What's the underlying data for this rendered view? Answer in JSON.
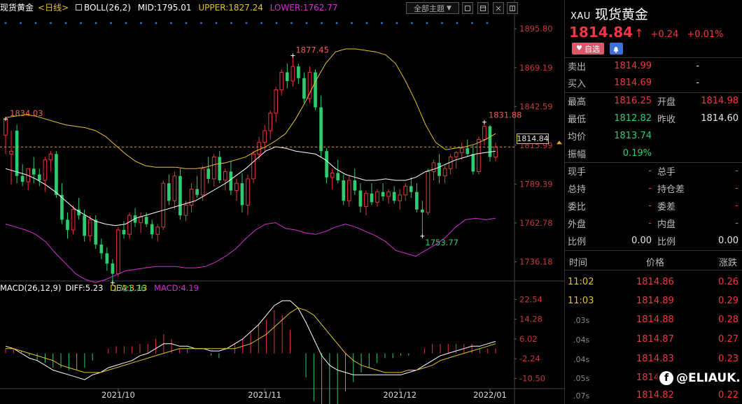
{
  "header": {
    "title": "现货黄金",
    "period": "<日线>",
    "boll": "BOLL(26,2)",
    "mid": "MID:1795.01",
    "upper": "UPPER:1827.24",
    "lower": "LOWER:1762.77",
    "theme_select": "全部主题",
    "theme_arrow": "▼"
  },
  "macd_header": {
    "label": "MACD(26,12,9)",
    "diff": "DIFF:5.23",
    "dea": "DEA:3.13",
    "macd": "MACD:4.19"
  },
  "current_price_tag": "1814.84",
  "chart_data": [
    {
      "type": "candlestick",
      "x_labels": [
        "2021/10",
        "2021/11",
        "2021/12",
        "2022/01"
      ],
      "price_axis_ticks": [
        "1895.80",
        "1869.19",
        "1842.59",
        "1815.99",
        "1789.39",
        "1762.78",
        "1736.18"
      ],
      "ylim": [
        1724,
        1905
      ],
      "annotations": [
        {
          "label": "1834.03",
          "value": 1834.03
        },
        {
          "label": "1721.76",
          "value": 1721.76
        },
        {
          "label": "1877.45",
          "value": 1877.45
        },
        {
          "label": "1753.77",
          "value": 1753.77
        },
        {
          "label": "1831.88",
          "value": 1831.88
        }
      ],
      "current_price_line": 1814.84,
      "candles": [
        [
          1823,
          1828,
          1810,
          1834.03
        ],
        [
          1810,
          1826,
          1789,
          1812
        ],
        [
          1826,
          1830,
          1790,
          1795
        ],
        [
          1795,
          1803,
          1788,
          1791
        ],
        [
          1791,
          1798,
          1785,
          1800
        ],
        [
          1800,
          1808,
          1790,
          1796
        ],
        [
          1796,
          1800,
          1788,
          1792
        ],
        [
          1792,
          1808,
          1784,
          1806
        ],
        [
          1806,
          1812,
          1798,
          1810
        ],
        [
          1810,
          1812,
          1780,
          1782
        ],
        [
          1782,
          1790,
          1762,
          1765
        ],
        [
          1765,
          1770,
          1752,
          1758
        ],
        [
          1758,
          1775,
          1755,
          1772
        ],
        [
          1772,
          1780,
          1765,
          1768
        ],
        [
          1768,
          1772,
          1750,
          1754
        ],
        [
          1754,
          1768,
          1750,
          1765
        ],
        [
          1765,
          1768,
          1745,
          1748
        ],
        [
          1748,
          1752,
          1738,
          1742
        ],
        [
          1742,
          1746,
          1730,
          1735
        ],
        [
          1735,
          1738,
          1721.76,
          1728
        ],
        [
          1728,
          1760,
          1726,
          1758
        ],
        [
          1758,
          1764,
          1752,
          1755
        ],
        [
          1755,
          1770,
          1752,
          1768
        ],
        [
          1768,
          1773,
          1760,
          1763
        ],
        [
          1763,
          1770,
          1756,
          1767
        ],
        [
          1767,
          1770,
          1760,
          1762
        ],
        [
          1762,
          1765,
          1752,
          1755
        ],
        [
          1755,
          1762,
          1750,
          1760
        ],
        [
          1760,
          1792,
          1758,
          1790
        ],
        [
          1790,
          1796,
          1775,
          1778
        ],
        [
          1778,
          1798,
          1772,
          1795
        ],
        [
          1795,
          1800,
          1765,
          1768
        ],
        [
          1768,
          1778,
          1764,
          1775
        ],
        [
          1775,
          1790,
          1770,
          1786
        ],
        [
          1786,
          1795,
          1780,
          1782
        ],
        [
          1782,
          1802,
          1778,
          1800
        ],
        [
          1800,
          1808,
          1790,
          1793
        ],
        [
          1793,
          1810,
          1788,
          1808
        ],
        [
          1808,
          1812,
          1790,
          1792
        ],
        [
          1792,
          1800,
          1785,
          1798
        ],
        [
          1798,
          1805,
          1782,
          1785
        ],
        [
          1785,
          1793,
          1778,
          1790
        ],
        [
          1790,
          1797,
          1770,
          1775
        ],
        [
          1775,
          1796,
          1768,
          1793
        ],
        [
          1793,
          1812,
          1790,
          1810
        ],
        [
          1810,
          1822,
          1806,
          1818
        ],
        [
          1818,
          1830,
          1812,
          1826
        ],
        [
          1826,
          1840,
          1820,
          1838
        ],
        [
          1838,
          1856,
          1832,
          1854
        ],
        [
          1854,
          1868,
          1850,
          1866
        ],
        [
          1866,
          1872,
          1855,
          1860
        ],
        [
          1860,
          1877.45,
          1856,
          1870
        ],
        [
          1870,
          1872,
          1858,
          1862
        ],
        [
          1862,
          1866,
          1845,
          1848
        ],
        [
          1848,
          1870,
          1845,
          1866
        ],
        [
          1866,
          1868,
          1840,
          1842
        ],
        [
          1842,
          1850,
          1808,
          1812
        ],
        [
          1812,
          1814,
          1790,
          1794
        ],
        [
          1794,
          1800,
          1786,
          1797
        ],
        [
          1797,
          1806,
          1790,
          1792
        ],
        [
          1792,
          1796,
          1775,
          1778
        ],
        [
          1778,
          1795,
          1774,
          1792
        ],
        [
          1792,
          1800,
          1782,
          1785
        ],
        [
          1785,
          1790,
          1770,
          1774
        ],
        [
          1774,
          1785,
          1768,
          1783
        ],
        [
          1783,
          1790,
          1775,
          1777
        ],
        [
          1777,
          1786,
          1774,
          1784
        ],
        [
          1784,
          1790,
          1778,
          1781
        ],
        [
          1781,
          1786,
          1776,
          1784
        ],
        [
          1784,
          1788,
          1776,
          1778
        ],
        [
          1778,
          1786,
          1772,
          1782
        ],
        [
          1782,
          1790,
          1778,
          1788
        ],
        [
          1788,
          1794,
          1780,
          1784
        ],
        [
          1784,
          1790,
          1770,
          1772
        ],
        [
          1772,
          1778,
          1753.77,
          1770
        ],
        [
          1770,
          1800,
          1768,
          1798
        ],
        [
          1798,
          1806,
          1792,
          1804
        ],
        [
          1804,
          1810,
          1790,
          1795
        ],
        [
          1795,
          1802,
          1790,
          1800
        ],
        [
          1800,
          1810,
          1796,
          1808
        ],
        [
          1808,
          1812,
          1800,
          1811
        ],
        [
          1811,
          1818,
          1806,
          1814
        ],
        [
          1814,
          1820,
          1808,
          1810
        ],
        [
          1810,
          1816,
          1796,
          1798
        ],
        [
          1798,
          1822,
          1796,
          1820
        ],
        [
          1820,
          1831.88,
          1816,
          1829
        ],
        [
          1829,
          1830,
          1805,
          1808
        ],
        [
          1808,
          1818,
          1805,
          1814.84
        ]
      ],
      "boll_upper": [
        1835,
        1836,
        1837,
        1836,
        1834,
        1832,
        1830,
        1829,
        1828,
        1826,
        1822,
        1816,
        1810,
        1805,
        1802,
        1801,
        1801,
        1801,
        1800,
        1800,
        1801,
        1803,
        1804,
        1806,
        1808,
        1812,
        1815,
        1819,
        1824,
        1834,
        1846,
        1860,
        1872,
        1880,
        1882,
        1882,
        1881,
        1880,
        1878,
        1872,
        1860,
        1846,
        1830,
        1818,
        1813,
        1814,
        1815,
        1817,
        1820,
        1824
      ],
      "boll_mid": [
        1800,
        1798,
        1796,
        1793,
        1789,
        1784,
        1778,
        1772,
        1768,
        1764,
        1762,
        1761,
        1762,
        1766,
        1768,
        1770,
        1772,
        1774,
        1776,
        1778,
        1782,
        1786,
        1790,
        1795,
        1800,
        1806,
        1812,
        1815,
        1814,
        1812,
        1811,
        1810,
        1806,
        1800,
        1796,
        1794,
        1792,
        1792,
        1793,
        1792,
        1792,
        1794,
        1798,
        1800,
        1803,
        1806,
        1808,
        1810,
        1811,
        1812
      ],
      "boll_lower": [
        1762,
        1760,
        1758,
        1755,
        1750,
        1742,
        1735,
        1728,
        1724,
        1722,
        1724,
        1727,
        1730,
        1731,
        1732,
        1733,
        1733,
        1733,
        1732,
        1732,
        1733,
        1736,
        1740,
        1745,
        1752,
        1758,
        1762,
        1763,
        1759,
        1758,
        1756,
        1755,
        1757,
        1760,
        1762,
        1760,
        1757,
        1754,
        1750,
        1744,
        1742,
        1740,
        1744,
        1748,
        1753,
        1760,
        1765,
        1766,
        1765,
        1766
      ]
    },
    {
      "type": "macd",
      "axis_ticks": [
        "22.54",
        "14.28",
        "6.02",
        "-2.24",
        "-10.50"
      ],
      "ylim": [
        -13,
        25
      ],
      "diff": [
        3,
        2,
        0,
        -2,
        -3,
        -5,
        -7,
        -8,
        -9,
        -10,
        -11,
        -9,
        -8,
        -6,
        -5,
        -4,
        -3,
        -1,
        0,
        2,
        4,
        4,
        3,
        3,
        2,
        2,
        1,
        1,
        2,
        4,
        6,
        9,
        12,
        16,
        20,
        22,
        22,
        19,
        13,
        6,
        -1,
        -5,
        -7,
        -8,
        -9,
        -9,
        -9,
        -9,
        -9,
        -9,
        -9,
        -8,
        -7,
        -5,
        -3,
        -1,
        0,
        1,
        2,
        3,
        3,
        4,
        5
      ],
      "dea": [
        2,
        2,
        1,
        0,
        -1,
        -2,
        -3,
        -5,
        -6,
        -7,
        -8,
        -8,
        -8,
        -7,
        -6,
        -5,
        -4,
        -3,
        -2,
        -1,
        0,
        1,
        2,
        2,
        2,
        2,
        2,
        2,
        2,
        2,
        3,
        4,
        6,
        8,
        11,
        14,
        17,
        19,
        18,
        16,
        12,
        8,
        4,
        0,
        -3,
        -5,
        -6,
        -7,
        -8,
        -8,
        -8,
        -7,
        -7,
        -6,
        -5,
        -3,
        -2,
        -1,
        0,
        1,
        2,
        3,
        4
      ],
      "macd_hist": [
        2,
        2,
        1,
        -1,
        -3,
        -4,
        -6,
        -6,
        -7,
        -7,
        -6,
        -3,
        0,
        2,
        3,
        3,
        3,
        4,
        4,
        6,
        8,
        6,
        2,
        2,
        0,
        0,
        -1,
        -2,
        0,
        4,
        6,
        9,
        12,
        14,
        18,
        16,
        10,
        0,
        -10,
        -20,
        -26,
        -26,
        -22,
        -16,
        -12,
        -8,
        -6,
        -4,
        -2,
        -2,
        -1,
        -1,
        0,
        2,
        4,
        4,
        4,
        4,
        4,
        4,
        2,
        2,
        2
      ]
    }
  ],
  "quote": {
    "code": "XAU",
    "name": "现货黄金",
    "price": "1814.84",
    "arrow": "↑",
    "change": "+0.24",
    "change_pct": "+0.01%",
    "fav_label": "自选",
    "sell_label": "卖出",
    "sell": "1814.99",
    "sell_vol": "-",
    "buy_label": "买入",
    "buy": "1814.69",
    "buy_vol": "-",
    "high_label": "最高",
    "high": "1816.25",
    "open_label": "开盘",
    "open": "1814.98",
    "low_label": "最低",
    "low": "1812.82",
    "prev_label": "昨收",
    "prev": "1814.60",
    "avg_label": "均价",
    "avg": "1813.74",
    "amp_label": "振幅",
    "amp": "0.19%",
    "cur_hand_label": "现手",
    "cur_hand": "-",
    "total_hand_label": "总手",
    "total_hand": "-",
    "total_vol_label": "总持",
    "total_vol": "-",
    "pos_diff_label": "持仓差",
    "pos_diff": "-",
    "bid_ratio_label": "委比",
    "bid_ratio": "-",
    "bid_diff_label": "委差",
    "bid_diff": "-",
    "outer_label": "外盘",
    "outer": "-",
    "inner_label": "内盘",
    "inner": "-",
    "ratio_label": "比例",
    "ratio": "0.00",
    "ratio2_label": "比例",
    "ratio2": "0.00"
  },
  "ticks": {
    "headers": [
      "时间",
      "价格",
      "涨跌"
    ],
    "rows": [
      {
        "time": "11:02",
        "price": "1814.86",
        "chg": "0.26"
      },
      {
        "time": "11:03",
        "price": "1814.89",
        "chg": "0.29"
      },
      {
        "time": ".03s",
        "price": "1814.88",
        "chg": "0.28"
      },
      {
        "time": ".04s",
        "price": "1814.87",
        "chg": "0.27"
      },
      {
        "time": ".04s",
        "price": "1814.83",
        "chg": "0.23"
      },
      {
        "time": ".05s",
        "price": "1814",
        "chg": ""
      },
      {
        "time": ".07s",
        "price": "1814.82",
        "chg": "0.22"
      }
    ]
  },
  "watermark": "@ELIAUK."
}
